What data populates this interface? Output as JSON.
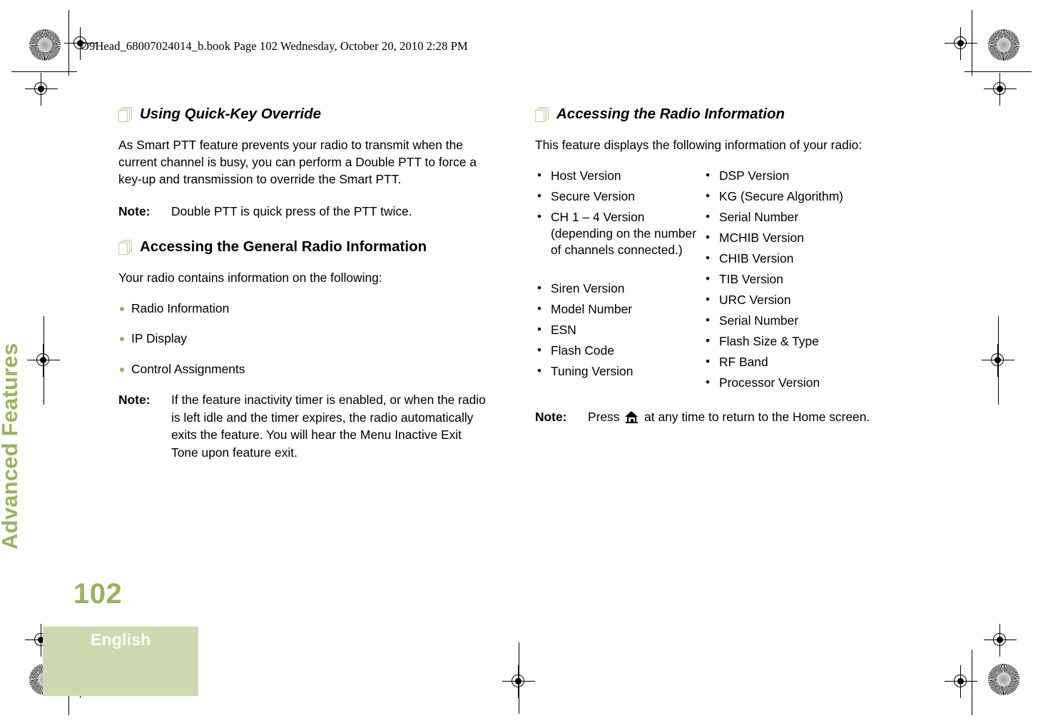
{
  "page": {
    "file_header": "O9Head_68007024014_b.book  Page 102  Wednesday, October 20, 2010  2:28 PM",
    "side_tab": "Advanced Features",
    "folio": "102",
    "language": "English",
    "accent_green": "#9bb35e",
    "block_green": "#cdd9ae",
    "icon_green": "#c2d19b"
  },
  "left_column": {
    "section1": {
      "icon": "pages-icon",
      "heading": "Using Quick-Key Override",
      "paragraph": "As Smart PTT feature prevents your radio to transmit when the current channel is busy, you can perform a Double PTT to force a key-up and transmission to override the Smart PTT.",
      "note_label": "Note:",
      "note_text": "Double PTT is quick press of the PTT twice."
    },
    "section2": {
      "icon": "pages-icon",
      "heading": "Accessing the General Radio Information",
      "paragraph": "Your radio contains information on the following:",
      "bullets": [
        "Radio Information",
        "IP Display",
        "Control Assignments"
      ],
      "note_label": "Note:",
      "note_text": "If the feature inactivity timer is enabled, or when the radio is left idle and the timer expires, the radio automatically exits the feature. You will hear the Menu Inactive Exit Tone upon feature exit."
    }
  },
  "right_column": {
    "section1": {
      "icon": "pages-icon",
      "heading": "Accessing the Radio Information",
      "paragraph": "This feature displays the following information of your radio:",
      "spec_column_1": [
        "Host Version",
        "Secure Version",
        "CH 1 – 4 Version (depending on the number of channels connected.)",
        "Siren Version",
        "Model Number",
        "ESN",
        "Flash Code",
        "Tuning Version"
      ],
      "spec_column_2": [
        "DSP Version",
        "KG (Secure Algorithm)",
        "Serial Number",
        "MCHIB Version",
        "CHIB Version",
        "TIB Version",
        "URC Version",
        "Serial Number",
        "Flash Size & Type",
        "RF Band",
        "Processor Version"
      ],
      "note_label": "Note:",
      "note_text_before": "Press",
      "note_icon": "home-icon",
      "note_text_after": "at any time to return to the Home screen."
    }
  }
}
